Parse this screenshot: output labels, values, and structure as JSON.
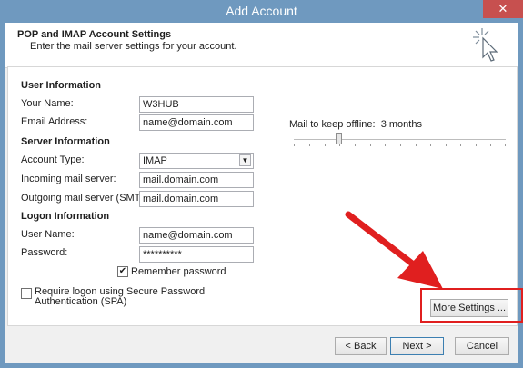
{
  "window": {
    "title": "Add Account",
    "close_label": "✕"
  },
  "header": {
    "title": "POP and IMAP Account Settings",
    "subtitle": "Enter the mail server settings for your account."
  },
  "user_info": {
    "section": "User Information",
    "name_label": "Your Name:",
    "name_value": "W3HUB",
    "email_label": "Email Address:",
    "email_value": "name@domain.com"
  },
  "server_info": {
    "section": "Server Information",
    "account_type_label": "Account Type:",
    "account_type_value": "IMAP",
    "incoming_label": "Incoming mail server:",
    "incoming_value": "mail.domain.com",
    "outgoing_label": "Outgoing mail server (SMTP):",
    "outgoing_value": "mail.domain.com"
  },
  "logon_info": {
    "section": "Logon Information",
    "username_label": "User Name:",
    "username_value": "name@domain.com",
    "password_label": "Password:",
    "password_value": "**********",
    "remember_label": "Remember password",
    "remember_checked": true,
    "spa_label": "Require logon using Secure Password Authentication (SPA)",
    "spa_checked": false
  },
  "offline": {
    "label": "Mail to keep offline:",
    "value": "3 months"
  },
  "buttons": {
    "more_settings": "More Settings ...",
    "back": "< Back",
    "next": "Next >",
    "cancel": "Cancel"
  },
  "annotation": {
    "color": "#e01f1f"
  }
}
